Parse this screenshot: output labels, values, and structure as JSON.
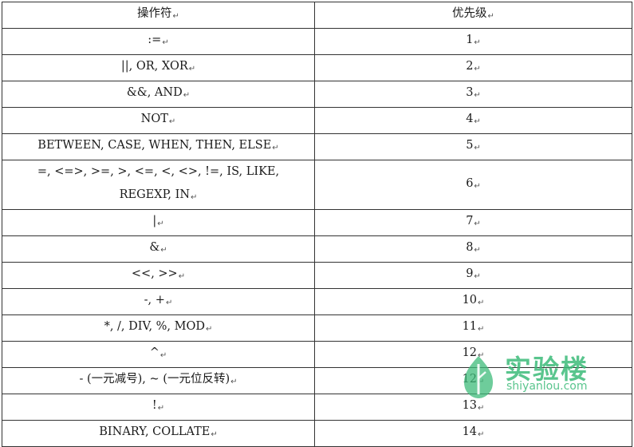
{
  "table": {
    "headers": {
      "operator": "操作符",
      "priority": "优先级"
    },
    "paragraph_mark": "↵",
    "rows": [
      {
        "operator": ":=",
        "priority": "1"
      },
      {
        "operator": "||, OR, XOR",
        "priority": "2"
      },
      {
        "operator": "&&, AND",
        "priority": "3"
      },
      {
        "operator": "NOT",
        "priority": "4"
      },
      {
        "operator": "BETWEEN, CASE, WHEN, THEN, ELSE",
        "priority": "5"
      },
      {
        "operator_line1": "=, <=>, >=, >, <=, <, <>, !=, IS, LIKE,",
        "operator_line2": "REGEXP, IN",
        "priority": "6"
      },
      {
        "operator": "|",
        "priority": "7"
      },
      {
        "operator": "&",
        "priority": "8"
      },
      {
        "operator": "<<, >>",
        "priority": "9"
      },
      {
        "operator": "-, +",
        "priority": "10"
      },
      {
        "operator": "*, /, DIV, %, MOD",
        "priority": "11"
      },
      {
        "operator": "^",
        "priority": "12"
      },
      {
        "operator": "- (一元减号), ~ (一元位反转)",
        "priority": "12"
      },
      {
        "operator": "!",
        "priority": "13"
      },
      {
        "operator": "BINARY, COLLATE",
        "priority": "14"
      }
    ]
  },
  "watermark": {
    "brand": "实验楼",
    "domain": "shiyanlou.com",
    "color": "#3dbb7a"
  }
}
